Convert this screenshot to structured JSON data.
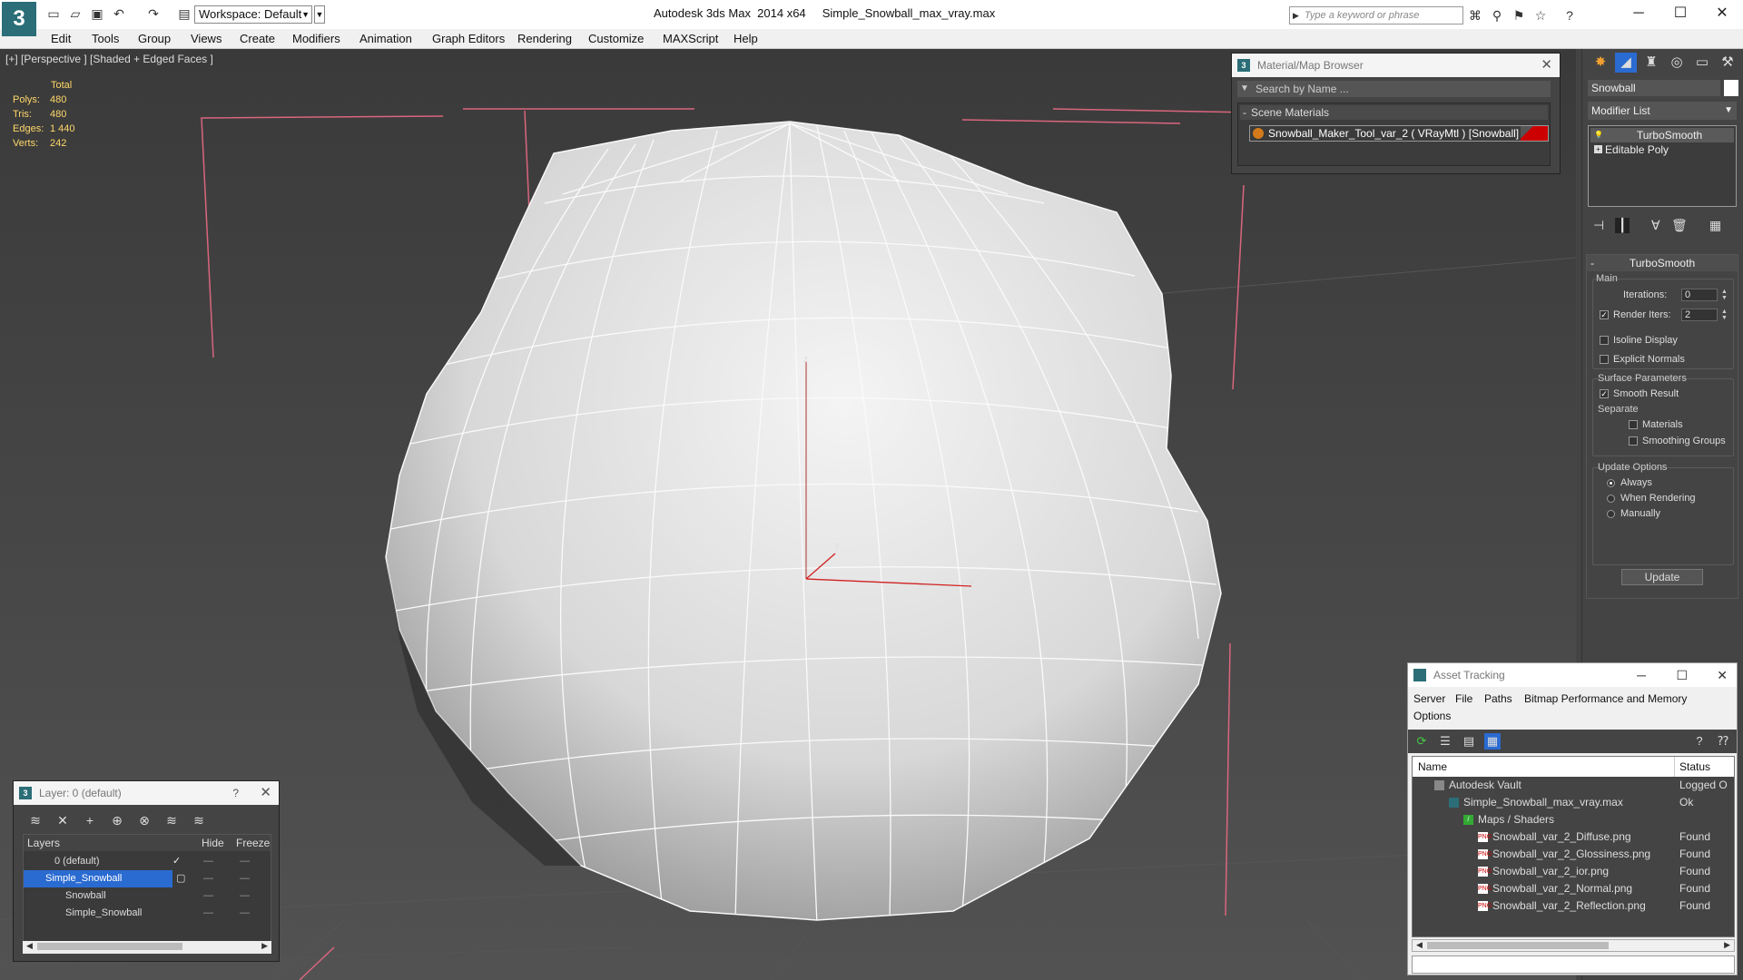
{
  "app": {
    "title": "Autodesk 3ds Max  2014 x64     Simple_Snowball_max_vray.max",
    "workspace": "Workspace: Default",
    "search_placeholder": "Type a keyword or phrase"
  },
  "menu": [
    "Edit",
    "Tools",
    "Group",
    "Views",
    "Create",
    "Modifiers",
    "Animation",
    "Graph Editors",
    "Rendering",
    "Customize",
    "MAXScript",
    "Help"
  ],
  "viewport": {
    "label": "[+] [Perspective ] [Shaded + Edged Faces ]",
    "stats_header": "Total",
    "stats": [
      {
        "label": "Polys:",
        "value": "480"
      },
      {
        "label": "Tris:",
        "value": "480"
      },
      {
        "label": "Edges:",
        "value": "1 440"
      },
      {
        "label": "Verts:",
        "value": "242"
      }
    ],
    "axes": {
      "x": "x",
      "y": "y",
      "z": "z"
    }
  },
  "material_browser": {
    "title": "Material/Map Browser",
    "search": "Search by Name ...",
    "category": "Scene Materials",
    "item": "Snowball_Maker_Tool_var_2  ( VRayMtl )  [Snowball]"
  },
  "command_panel": {
    "object_name": "Snowball",
    "modifier_list": "Modifier List",
    "stack": [
      "TurboSmooth",
      "Editable Poly"
    ],
    "rollout_title": "TurboSmooth",
    "main_label": "Main",
    "iterations_label": "Iterations:",
    "iterations_value": "0",
    "render_iters_label": "Render Iters:",
    "render_iters_value": "2",
    "isoline": "Isoline Display",
    "explicit": "Explicit Normals",
    "surface_label": "Surface Parameters",
    "smooth_result": "Smooth Result",
    "separate_label": "Separate",
    "materials": "Materials",
    "smoothing_groups": "Smoothing Groups",
    "update_label": "Update Options",
    "always": "Always",
    "when_rendering": "When Rendering",
    "manually": "Manually",
    "update_button": "Update"
  },
  "asset_tracking": {
    "title": "Asset Tracking",
    "menus": [
      "Server",
      "File",
      "Paths",
      "Bitmap Performance and Memory",
      "Options"
    ],
    "col_name": "Name",
    "col_status": "Status",
    "rows": [
      {
        "name": "Autodesk Vault",
        "status": "Logged O",
        "indent": 1
      },
      {
        "name": "Simple_Snowball_max_vray.max",
        "status": "Ok",
        "indent": 2
      },
      {
        "name": "Maps / Shaders",
        "status": "",
        "indent": 3
      },
      {
        "name": "Snowball_var_2_Diffuse.png",
        "status": "Found",
        "indent": 4
      },
      {
        "name": "Snowball_var_2_Glossiness.png",
        "status": "Found",
        "indent": 4
      },
      {
        "name": "Snowball_var_2_ior.png",
        "status": "Found",
        "indent": 4
      },
      {
        "name": "Snowball_var_2_Normal.png",
        "status": "Found",
        "indent": 4
      },
      {
        "name": "Snowball_var_2_Reflection.png",
        "status": "Found",
        "indent": 4
      }
    ]
  },
  "layer_manager": {
    "title": "Layer: 0 (default)",
    "col_layers": "Layers",
    "col_hide": "Hide",
    "col_freeze": "Freeze",
    "rows": [
      "0 (default)",
      "Simple_Snowball",
      "Snowball",
      "Simple_Snowball"
    ]
  },
  "colors": {
    "accent": "#2b6e77",
    "selection": "#2a6bd1",
    "stats": "#ffd86a",
    "grid_line": "#e0607a"
  }
}
